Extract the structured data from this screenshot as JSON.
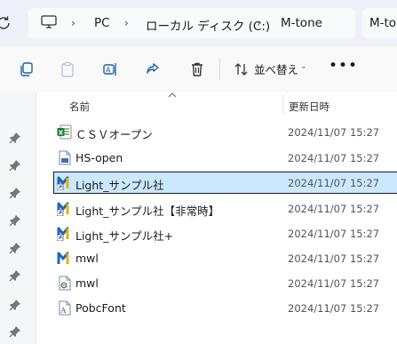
{
  "addressbar": {
    "crumbs": [
      "PC",
      "ローカル ディスク (C:)",
      "M-tone"
    ],
    "next_tab": "M-to"
  },
  "toolbar": {
    "sort_label": "並べ替え",
    "more": "•••"
  },
  "header": {
    "name": "名前",
    "date": "更新日時"
  },
  "files": [
    {
      "name": "ＣＳＶオープン",
      "date": "2024/11/07 15:27",
      "icon": "excel-csv-icon"
    },
    {
      "name": "HS-open",
      "date": "2024/11/07 15:27",
      "icon": "document-icon"
    },
    {
      "name": "Light_サンプル社",
      "date": "2024/11/07 15:27",
      "icon": "app-shortcut-icon",
      "selected": true
    },
    {
      "name": "Light_サンプル社【非常時】",
      "date": "2024/11/07 15:27",
      "icon": "app-shortcut-icon"
    },
    {
      "name": "Light_サンプル社+",
      "date": "2024/11/07 15:27",
      "icon": "app-shortcut-icon"
    },
    {
      "name": "mwl",
      "date": "2024/11/07 15:27",
      "icon": "app-icon"
    },
    {
      "name": "mwl",
      "date": "2024/11/07 15:27",
      "icon": "config-file-icon"
    },
    {
      "name": "PobcFont",
      "date": "2024/11/07 15:27",
      "icon": "font-file-icon"
    }
  ],
  "colors": {
    "selection": "#cce8ff",
    "accent": "#0067c0"
  }
}
